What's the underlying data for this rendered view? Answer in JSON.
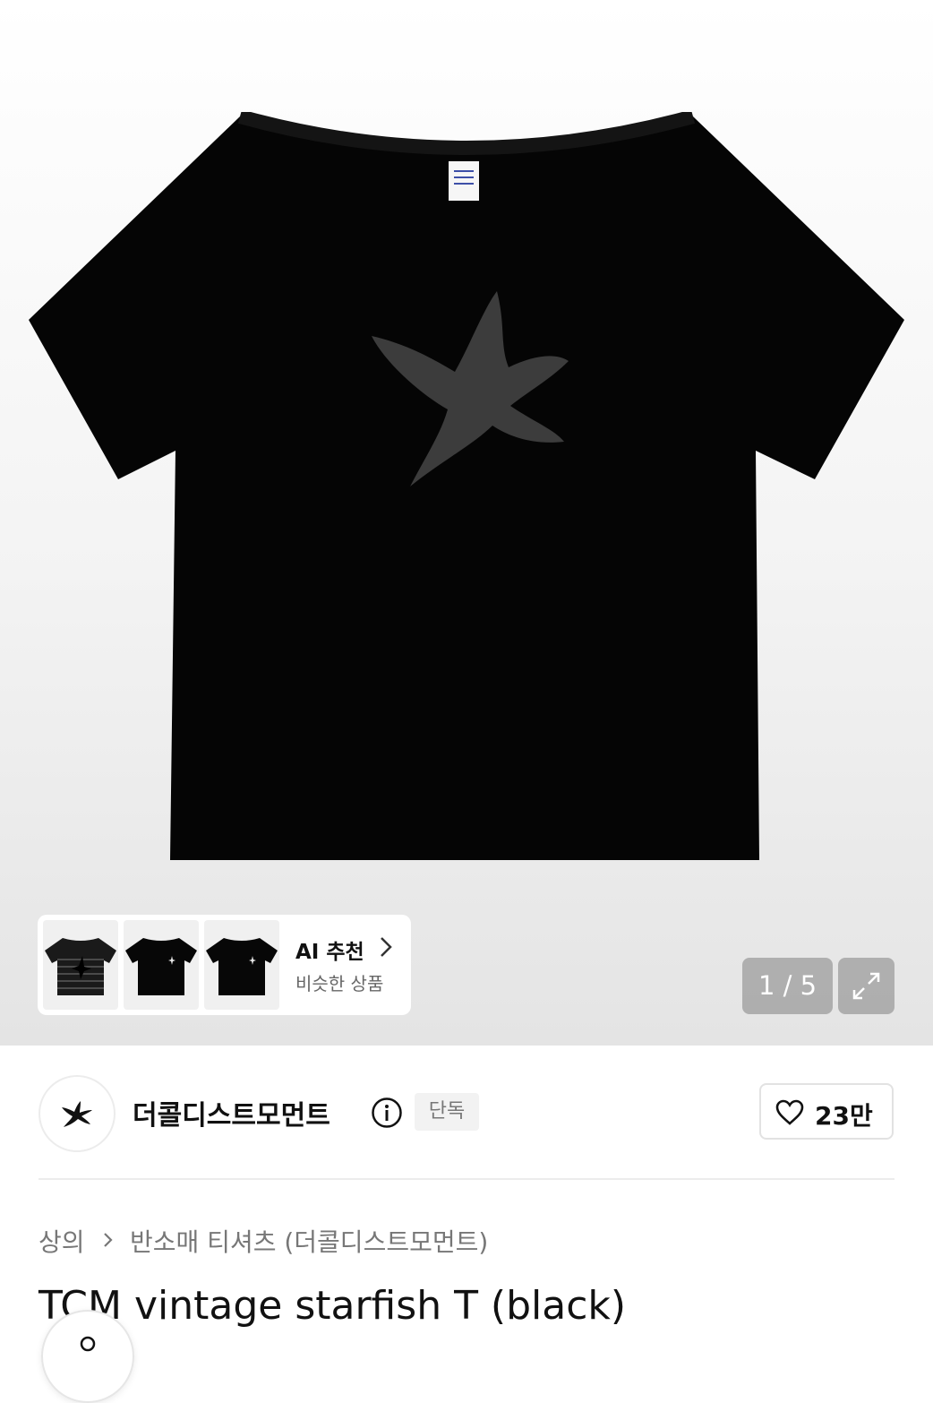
{
  "gallery": {
    "ai_reco_title": "AI 추천",
    "ai_reco_subtitle": "비슷한 상품",
    "image_counter": "1 / 5"
  },
  "brand": {
    "name": "더콜디스트모먼트",
    "badge": "단독",
    "likes": "23만"
  },
  "breadcrumb": {
    "category": "상의",
    "subcategory": "반소매 티셔츠 (더콜디스트모먼트)"
  },
  "product": {
    "title": "TCM vintage starfish T (black)"
  }
}
